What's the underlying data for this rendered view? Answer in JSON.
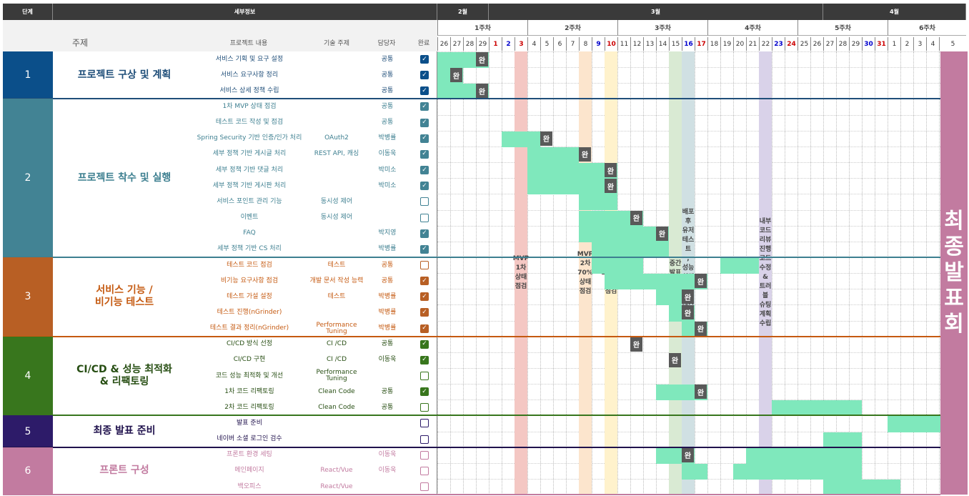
{
  "header": {
    "stage": "단계",
    "detail": "세부정보",
    "feb": "2월",
    "mar": "3월",
    "apr": "4월"
  },
  "subheader": {
    "topic": "주제",
    "content": "프로젝트 내용",
    "tech": "기술 주제",
    "owner": "담당자",
    "done": "완료"
  },
  "weeks": [
    "1주차",
    "2주차",
    "3주차",
    "4주차",
    "5주차",
    "6주차"
  ],
  "days": [
    {
      "d": "26",
      "c": "k"
    },
    {
      "d": "27",
      "c": "k"
    },
    {
      "d": "28",
      "c": "k"
    },
    {
      "d": "29",
      "c": "k"
    },
    {
      "d": "1",
      "c": "r"
    },
    {
      "d": "2",
      "c": "b"
    },
    {
      "d": "3",
      "c": "r"
    },
    {
      "d": "4",
      "c": "k"
    },
    {
      "d": "5",
      "c": "k"
    },
    {
      "d": "6",
      "c": "k"
    },
    {
      "d": "7",
      "c": "k"
    },
    {
      "d": "8",
      "c": "k"
    },
    {
      "d": "9",
      "c": "b"
    },
    {
      "d": "10",
      "c": "r"
    },
    {
      "d": "11",
      "c": "k"
    },
    {
      "d": "12",
      "c": "k"
    },
    {
      "d": "13",
      "c": "k"
    },
    {
      "d": "14",
      "c": "k"
    },
    {
      "d": "15",
      "c": "k"
    },
    {
      "d": "16",
      "c": "b"
    },
    {
      "d": "17",
      "c": "r"
    },
    {
      "d": "18",
      "c": "k"
    },
    {
      "d": "19",
      "c": "k"
    },
    {
      "d": "20",
      "c": "k"
    },
    {
      "d": "21",
      "c": "k"
    },
    {
      "d": "22",
      "c": "k"
    },
    {
      "d": "23",
      "c": "b"
    },
    {
      "d": "24",
      "c": "r"
    },
    {
      "d": "25",
      "c": "k"
    },
    {
      "d": "26",
      "c": "k"
    },
    {
      "d": "27",
      "c": "k"
    },
    {
      "d": "28",
      "c": "k"
    },
    {
      "d": "29",
      "c": "k"
    },
    {
      "d": "30",
      "c": "b"
    },
    {
      "d": "31",
      "c": "r"
    },
    {
      "d": "1",
      "c": "k"
    },
    {
      "d": "2",
      "c": "k"
    },
    {
      "d": "3",
      "c": "k"
    },
    {
      "d": "4",
      "c": "k"
    },
    {
      "d": "5",
      "c": "k"
    }
  ],
  "stages": [
    {
      "num": "1",
      "title": "프로젝트 구상 및 계획",
      "color": "#0b4f8a",
      "tcolor": "#1f4e79",
      "sep": "#1f4e79",
      "rows": [
        {
          "content": "서비스 기획 및 요구 설정",
          "tech": "",
          "owner": "공통",
          "state": "checked"
        },
        {
          "content": "서비스 요구사항 정리",
          "tech": "",
          "owner": "공통",
          "state": "checked"
        },
        {
          "content": "서비스 상세 정책 수립",
          "tech": "",
          "owner": "공통",
          "state": "checked"
        }
      ]
    },
    {
      "num": "2",
      "title": "프로젝트 착수 및 실행",
      "color": "#428394",
      "tcolor": "#3d7f90",
      "sep": "#3d7f90",
      "rows": [
        {
          "content": "1차 MVP 상태 점검",
          "tech": "",
          "owner": "공통",
          "state": "checked"
        },
        {
          "content": "테스트 코드 작성 및 점검",
          "tech": "",
          "owner": "공통",
          "state": "checked"
        },
        {
          "content": "Spring Security 기반 인증/인가 처리",
          "tech": "OAuth2",
          "owner": "박병률",
          "state": "checked"
        },
        {
          "content": "세부 정책 기반 게시글 처리",
          "tech": "REST API, 캐싱",
          "owner": "이동욱",
          "state": "checked"
        },
        {
          "content": "세부 정책 기반 댓글 처리",
          "tech": "",
          "owner": "박미소",
          "state": "checked"
        },
        {
          "content": "세부 정책 기반 게시판 처리",
          "tech": "",
          "owner": "박미소",
          "state": "checked"
        },
        {
          "content": "서비스 포인트 관리 기능",
          "tech": "동시성 제어",
          "owner": "",
          "state": "empty"
        },
        {
          "content": "이벤트",
          "tech": "동시성 제어",
          "owner": "",
          "state": "empty"
        },
        {
          "content": "FAQ",
          "tech": "",
          "owner": "박지영",
          "state": "checked"
        },
        {
          "content": "세부 정책 기반 CS 처리",
          "tech": "",
          "owner": "박병률",
          "state": "checked"
        }
      ]
    },
    {
      "num": "3",
      "title": "서비스 기능 /\n비기능 테스트",
      "color": "#b85f24",
      "tcolor": "#c55a11",
      "sep": "#c55a11",
      "rows": [
        {
          "content": "테스트 코드 점검",
          "tech": "테스트",
          "owner": "공통",
          "state": "empty"
        },
        {
          "content": "비기능 요구사항 점검",
          "tech": "개발 문서 작성 능력",
          "owner": "공통",
          "state": "checked"
        },
        {
          "content": "테스트 가설 설정",
          "tech": "테스트",
          "owner": "박병률",
          "state": "checked"
        },
        {
          "content": "테스트 진행(nGrinder)",
          "tech": "",
          "owner": "박병률",
          "state": "checked"
        },
        {
          "content": "테스트 결과 정리(nGrinder)",
          "tech": "Performance Tuning",
          "owner": "박병률",
          "state": "checked"
        }
      ]
    },
    {
      "num": "4",
      "title": "CI/CD & 성능 최적화\n& 리팩토링",
      "color": "#38761d",
      "tcolor": "#274e13",
      "sep": "#38761d",
      "rows": [
        {
          "content": "CI/CD 방식 선정",
          "tech": "CI /CD",
          "owner": "공통",
          "state": "checked"
        },
        {
          "content": "CI/CD 구현",
          "tech": "CI /CD",
          "owner": "이동욱",
          "state": "checked"
        },
        {
          "content": "코드 성능 최적화 및 개선",
          "tech": "Performance Tuning",
          "owner": "",
          "state": "empty"
        },
        {
          "content": "1차 코드 리팩토링",
          "tech": "Clean Code",
          "owner": "공통",
          "state": "checked"
        },
        {
          "content": "2차 코드 리팩토링",
          "tech": "Clean Code",
          "owner": "공통",
          "state": "empty"
        }
      ]
    },
    {
      "num": "5",
      "title": "최종 발표 준비",
      "color": "#2d1b69",
      "tcolor": "#20124d",
      "sep": "#20124d",
      "rows": [
        {
          "content": "발표 준비",
          "tech": "",
          "owner": "",
          "state": "empty"
        },
        {
          "content": "네이버 소셜 로그인 검수",
          "tech": "",
          "owner": "",
          "state": "empty"
        }
      ]
    },
    {
      "num": "6",
      "title": "프론트 구성",
      "color": "#c27ba0",
      "tcolor": "#c27ba0",
      "sep": "#c27ba0",
      "rows": [
        {
          "content": "프론트 환경 세팅",
          "tech": "",
          "owner": "이동욱",
          "state": "empty"
        },
        {
          "content": "메인페이지",
          "tech": "React/Vue",
          "owner": "이동욱",
          "state": "empty"
        },
        {
          "content": "백오피스",
          "tech": "React/Vue",
          "owner": "",
          "state": "empty"
        }
      ]
    }
  ],
  "bands": [
    {
      "day": 6,
      "text": "MVP\n1차\n상태\n점검",
      "color": "#f4c7c3"
    },
    {
      "day": 11,
      "text": "MVP\n2차\n70%\n상태\n점검",
      "color": "#fce5cd"
    },
    {
      "day": 13,
      "text": "MVP\n3차\n100%\n상태\n점검",
      "color": "#fff2cc"
    },
    {
      "day": 18,
      "text": "중간\n발표회",
      "color": "#d9ead3"
    },
    {
      "day": 19,
      "text": "배포\n후\n유저\n테스트\n,\n성능\n최적화\n및\n테스트\n가설\n수립",
      "color": "#d0e0e3"
    },
    {
      "day": 25,
      "text": "내부\n코드리뷰\n진행\n코드\n수정\n&\n트러블\n슈팅\n계획\n수립",
      "color": "#d9d2e9"
    }
  ],
  "final": "최종발표회",
  "done_label": "완",
  "check_mark": "✓",
  "gantt": [
    {
      "row": 0,
      "bars": [
        [
          0,
          3
        ]
      ],
      "done": [
        3
      ]
    },
    {
      "row": 1,
      "bars": [
        [
          0,
          1
        ]
      ],
      "done": [
        1
      ]
    },
    {
      "row": 2,
      "bars": [
        [
          0,
          3
        ]
      ],
      "done": [
        3
      ]
    },
    {
      "row": 5,
      "bars": [
        [
          5,
          7
        ]
      ],
      "done": [
        8
      ]
    },
    {
      "row": 6,
      "bars": [
        [
          7,
          10
        ]
      ],
      "done": [
        11
      ]
    },
    {
      "row": 7,
      "bars": [
        [
          7,
          13
        ]
      ],
      "done": [
        13
      ]
    },
    {
      "row": 8,
      "bars": [
        [
          7,
          13
        ]
      ],
      "done": [
        13
      ]
    },
    {
      "row": 9,
      "bars": [
        [
          11,
          13
        ]
      ],
      "done": []
    },
    {
      "row": 10,
      "bars": [
        [
          11,
          15
        ]
      ],
      "done": [
        15
      ]
    },
    {
      "row": 11,
      "bars": [
        [
          11,
          17
        ]
      ],
      "done": [
        17
      ]
    },
    {
      "row": 12,
      "bars": [
        [
          12,
          17
        ]
      ],
      "done": []
    },
    {
      "row": 13,
      "bars": [
        [
          12,
          15
        ],
        [
          22,
          24
        ]
      ],
      "done": []
    },
    {
      "row": 14,
      "bars": [
        [
          13,
          20
        ]
      ],
      "done": [
        20
      ]
    },
    {
      "row": 15,
      "bars": [
        [
          17,
          18
        ]
      ],
      "done": [
        19
      ]
    },
    {
      "row": 16,
      "bars": [
        [
          18,
          19
        ]
      ],
      "done": [
        19
      ]
    },
    {
      "row": 17,
      "bars": [
        [
          19,
          20
        ]
      ],
      "done": [
        20
      ]
    },
    {
      "row": 18,
      "bars": [],
      "done": [
        15
      ]
    },
    {
      "row": 19,
      "bars": [],
      "done": [
        18
      ]
    },
    {
      "row": 20,
      "bars": [],
      "done": []
    },
    {
      "row": 21,
      "bars": [
        [
          17,
          20
        ]
      ],
      "done": [
        20
      ]
    },
    {
      "row": 22,
      "bars": [
        [
          26,
          32
        ]
      ],
      "done": []
    },
    {
      "row": 23,
      "bars": [
        [
          35,
          39
        ]
      ],
      "done": []
    },
    {
      "row": 24,
      "bars": [
        [
          30,
          32
        ]
      ],
      "done": []
    },
    {
      "row": 25,
      "bars": [
        [
          17,
          19
        ],
        [
          24,
          32
        ]
      ],
      "done": [
        19
      ]
    },
    {
      "row": 26,
      "bars": [
        [
          19,
          20
        ],
        [
          23,
          32
        ]
      ],
      "done": []
    },
    {
      "row": 27,
      "bars": [
        [
          30,
          35
        ]
      ],
      "done": []
    }
  ]
}
